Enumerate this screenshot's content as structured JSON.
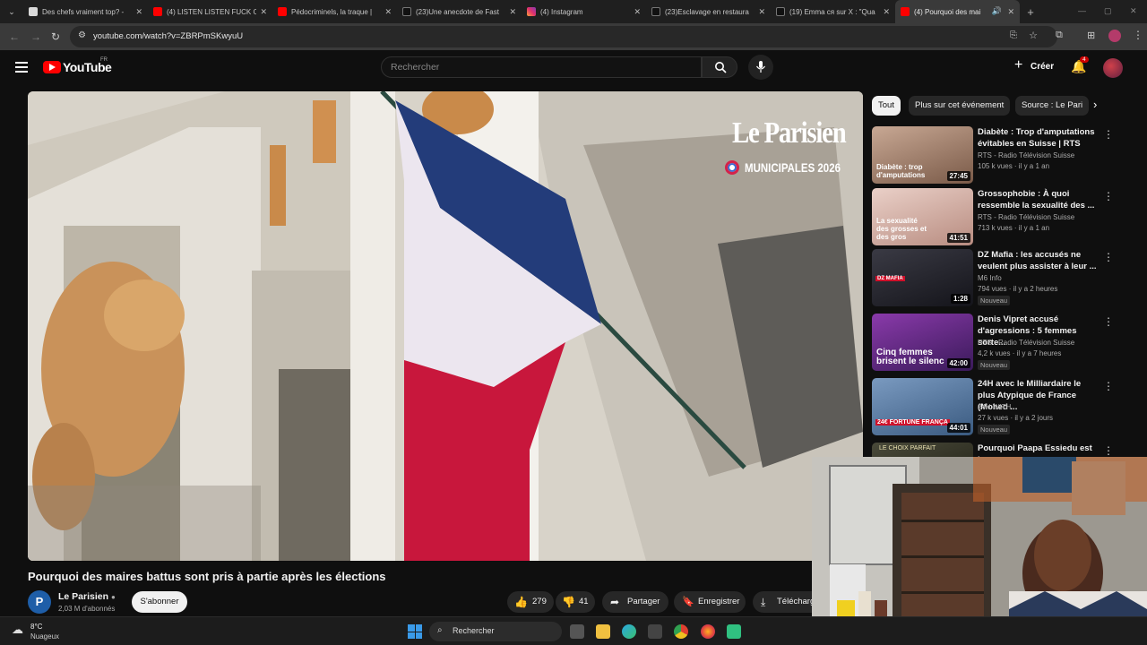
{
  "browser": {
    "tabs": [
      {
        "title": "Des chefs vraiment top? -",
        "color": "#d9d9d9"
      },
      {
        "title": "(4) LISTEN LISTEN FUCK C",
        "color": "#ff0000"
      },
      {
        "title": "Pédocriminels, la traque |",
        "color": "#ff0000"
      },
      {
        "title": "(23)Une anecdote de Fast",
        "color": "#111111"
      },
      {
        "title": "(4) Instagram",
        "color": "#e1306c"
      },
      {
        "title": "(23)Esclavage en restaura",
        "color": "#111111"
      },
      {
        "title": "(19) Emma ся sur X : \"Qua",
        "color": "#111111"
      },
      {
        "title": "(4) Pourquoi des mai",
        "color": "#ff0000"
      }
    ],
    "url": "youtube.com/watch?v=ZBRPmSKwyuU"
  },
  "youtube": {
    "logo_text": "YouTube",
    "logo_region": "FR",
    "search_placeholder": "Rechercher",
    "create_label": "Créer",
    "notification_count": "4"
  },
  "video": {
    "overlay_brand": "Le Parisien",
    "overlay_tag": "MUNICIPALES 2026",
    "title": "Pourquoi des maires battus sont pris à partie après les élections",
    "channel": "Le Parisien",
    "channel_initial": "P",
    "subscribers": "2,03 M d'abonnés",
    "subscribe_label": "S'abonner",
    "likes": "279",
    "dislikes": "41",
    "share_label": "Partager",
    "save_label": "Enregistrer",
    "download_label": "Télécharg"
  },
  "chips": [
    "Tout",
    "Plus sur cet événement",
    "Source : Le Pari"
  ],
  "recommendations": [
    {
      "title": "Diabète : Trop d'amputations évitables en Suisse | RTS",
      "channel": "RTS - Radio Télévision Suisse",
      "meta": "105 k vues · il y a 1 an",
      "duration": "27:45",
      "thumb_text": "Diabète : trop d'amputations",
      "badge": "",
      "thumb_color": "#9a7a66"
    },
    {
      "title": "Grossophobie : À quoi ressemble la sexualité des ...",
      "channel": "RTS - Radio Télévision Suisse",
      "meta": "713 k vues · il y a 1 an",
      "duration": "41:51",
      "thumb_text": "La sexualité des grosses et des gros",
      "badge": "",
      "thumb_color": "#d4b4ac"
    },
    {
      "title": "DZ Mafia : les accusés ne veulent plus assister à leur ...",
      "channel": "M6 Info",
      "meta": "794 vues · il y a 2 heures",
      "duration": "1:28",
      "thumb_text": "DZ MAFIA",
      "badge": "Nouveau",
      "thumb_color": "#2a2a30"
    },
    {
      "title": "Denis Vipret accusé d'agressions : 5 femmes sorte...",
      "channel": "RTS - Radio Télévision Suisse",
      "meta": "4,2 k vues · il y a 7 heures",
      "duration": "42:00",
      "thumb_text": "Cinq femmes brisent le silenc",
      "badge": "Nouveau",
      "thumb_color": "#6a2a8a"
    },
    {
      "title": "24H avec le Milliardaire le plus Atypique de France (Mohed ...",
      "channel": "24H WITH",
      "meta": "27 k vues · il y a 2 jours",
      "duration": "44:01",
      "thumb_text": "24€ FORTUNE FRANÇA",
      "badge": "Nouveau",
      "thumb_color": "#5a7aa0"
    },
    {
      "title": "Pourquoi Paapa Essiedu est le",
      "channel": "",
      "meta": "",
      "duration": "",
      "thumb_text": "LE CHOIX PARFAIT",
      "badge": "",
      "thumb_color": "#3a3a2a"
    }
  ],
  "taskbar": {
    "weather_temp": "8°C",
    "weather_desc": "Nuageux",
    "search_label": "Rechercher"
  },
  "colors": {
    "youtube_red": "#ff0000",
    "background": "#0f0f0f",
    "chip_active": "#f1f1f1"
  }
}
